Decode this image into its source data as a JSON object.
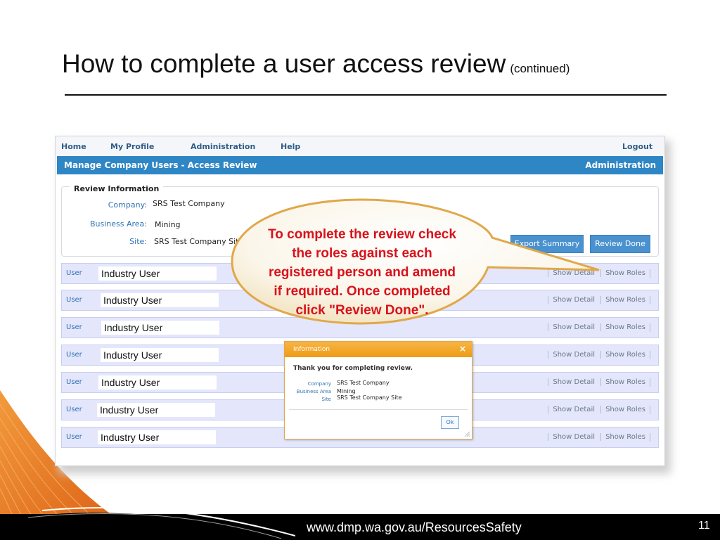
{
  "slide": {
    "title": "How to complete a user access review",
    "title_suffix": "(continued)",
    "footer_url": "www.dmp.wa.gov.au/ResourcesSafety",
    "page_number": "11"
  },
  "app": {
    "nav": {
      "home": "Home",
      "my_profile": "My Profile",
      "administration": "Administration",
      "help": "Help",
      "logout": "Logout"
    },
    "panel_title": "Manage Company Users - Access Review",
    "panel_right": "Administration",
    "review": {
      "legend": "Review Information",
      "company_label": "Company:",
      "company_value": "SRS Test Company",
      "area_label": "Business Area:",
      "area_value": "Mining",
      "site_label": "Site:",
      "site_value": "SRS Test Company Site"
    },
    "buttons": {
      "export_summary": "Export Summary",
      "review_done": "Review Done"
    },
    "rows": [
      {
        "type": "User",
        "name": "Industry User",
        "show_detail": "Show Detail",
        "show_roles": "Show Roles"
      },
      {
        "type": "User",
        "name": "Industry User",
        "show_detail": "Show Detail",
        "show_roles": "Show Roles"
      },
      {
        "type": "User",
        "name": "Industry User",
        "show_detail": "Show Detail",
        "show_roles": "Show Roles"
      },
      {
        "type": "User",
        "name": "Industry User",
        "show_detail": "Show Detail",
        "show_roles": "Show Roles"
      },
      {
        "type": "User",
        "name": "Industry User",
        "show_detail": "Show Detail",
        "show_roles": "Show Roles"
      },
      {
        "type": "User",
        "name": "Industry User",
        "show_detail": "Show Detail",
        "show_roles": "Show Roles"
      },
      {
        "type": "User",
        "name": "Industry User",
        "show_detail": "Show Detail",
        "show_roles": "Show Roles"
      }
    ]
  },
  "dialog": {
    "title": "Information",
    "close": "×",
    "message": "Thank you for completing review.",
    "company_label": "Company",
    "company_value": "SRS Test Company",
    "area_label": "Business Area",
    "area_value": "Mining",
    "site_label": "Site",
    "site_value": "SRS Test Company Site",
    "ok_label": "Ok"
  },
  "callout": {
    "lines": [
      "To complete the review check",
      "the roles against each",
      "registered person and amend",
      "if required. Once completed",
      "click \"Review Done\"."
    ]
  },
  "colors": {
    "accent": "#2f86c5",
    "callout_text": "#d9121b",
    "dialog_header": "#ef9a16",
    "swoosh": "#e8731e"
  }
}
